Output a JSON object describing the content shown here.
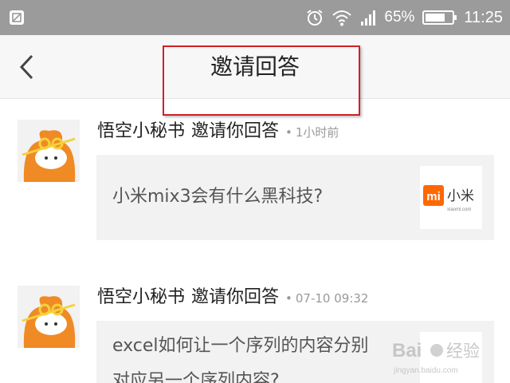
{
  "status_bar": {
    "battery_percent": "65%",
    "time": "11:25"
  },
  "header": {
    "title": "邀请回答"
  },
  "feed": [
    {
      "author": "悟空小秘书",
      "action": "邀请你回答",
      "separator": "•",
      "time": "1小时前",
      "question": "小米mix3会有什么黑科技?",
      "thumb_logo_text": "小米",
      "thumb_logo_sub": "xiaomi.com",
      "thumb_mi": "mi"
    },
    {
      "author": "悟空小秘书",
      "action": "邀请你回答",
      "separator": "•",
      "time": "07-10 09:32",
      "question_line1": "excel如何让一个序列的内容分别",
      "question_line2": "对应另一个序列内容?"
    }
  ],
  "watermark": {
    "text1": "Bai",
    "text2": "经验",
    "sub": "jingyan.baidu.com"
  },
  "colors": {
    "status_bar_bg": "#9b9b9b",
    "title_bar_bg": "#f7f7f7",
    "highlight_border": "#d32025",
    "avatar_orange": "#f08a24",
    "mi_orange": "#ff6700"
  }
}
